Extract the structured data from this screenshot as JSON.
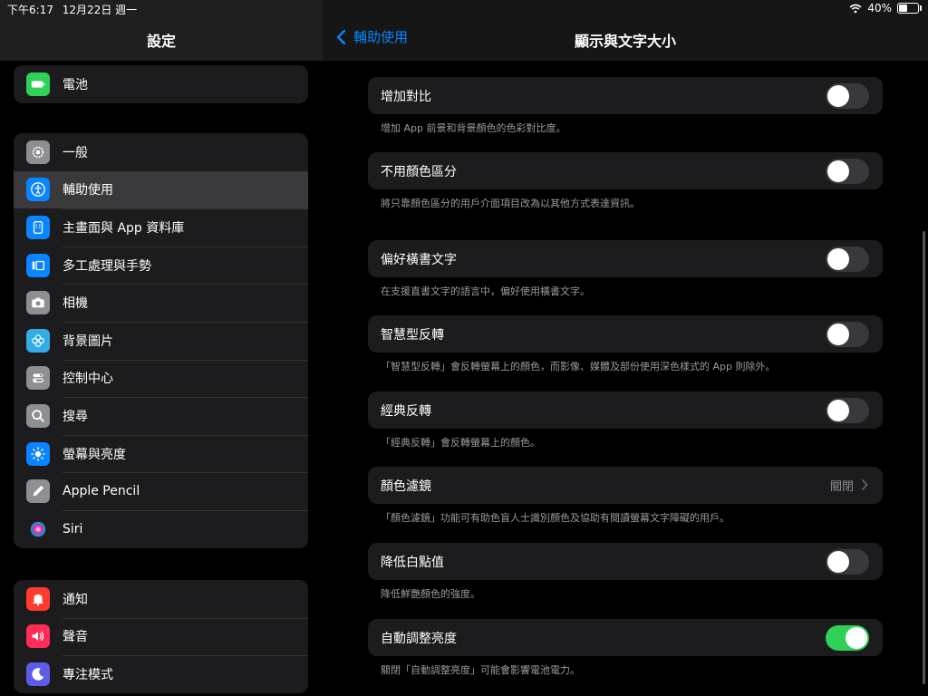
{
  "status": {
    "time": "下午6:17",
    "date": "12月22日 週一",
    "battery": "40%"
  },
  "sidebar": {
    "title": "設定",
    "group_top": [
      {
        "label": "電池",
        "icon": "battery-icon",
        "color": "#30d158"
      }
    ],
    "group_main": [
      {
        "label": "一般",
        "icon": "gear-icon",
        "color": "#8e8e93"
      },
      {
        "label": "輔助使用",
        "icon": "accessibility-icon",
        "color": "#0a84ff",
        "selected": true
      },
      {
        "label": "主畫面與 App 資料庫",
        "icon": "home-screen-icon",
        "color": "#0a84ff"
      },
      {
        "label": "多工處理與手勢",
        "icon": "multitasking-icon",
        "color": "#0a84ff"
      },
      {
        "label": "相機",
        "icon": "camera-icon",
        "color": "#8e8e93"
      },
      {
        "label": "背景圖片",
        "icon": "wallpaper-icon",
        "color": "#32ade6"
      },
      {
        "label": "控制中心",
        "icon": "control-center-icon",
        "color": "#8e8e93"
      },
      {
        "label": "搜尋",
        "icon": "search-icon",
        "color": "#8e8e93"
      },
      {
        "label": "螢幕與亮度",
        "icon": "brightness-icon",
        "color": "#0a84ff"
      },
      {
        "label": "Apple Pencil",
        "icon": "pencil-icon",
        "color": "#8e8e93"
      },
      {
        "label": "Siri",
        "icon": "siri-icon",
        "color": "#1c1c1e"
      }
    ],
    "group_bottom": [
      {
        "label": "通知",
        "icon": "notification-icon",
        "color": "#ff3b30"
      },
      {
        "label": "聲音",
        "icon": "sound-icon",
        "color": "#ff2d55"
      },
      {
        "label": "專注模式",
        "icon": "moon-icon",
        "color": "#5e5ce6"
      }
    ]
  },
  "main": {
    "back_label": "輔助使用",
    "title": "顯示與文字大小",
    "rows": [
      {
        "label": "增加對比",
        "type": "toggle",
        "on": false,
        "desc": "增加 App 前景和背景顏色的色彩對比度。"
      },
      {
        "label": "不用顏色區分",
        "type": "toggle",
        "on": false,
        "desc": "將只靠顏色區分的用戶介面項目改為以其他方式表達資訊。"
      },
      {
        "label": "偏好橫書文字",
        "type": "toggle",
        "on": false,
        "desc": "在支援直書文字的語言中，偏好使用橫書文字。"
      },
      {
        "label": "智慧型反轉",
        "type": "toggle",
        "on": false,
        "desc": "「智慧型反轉」會反轉螢幕上的顏色，而影像、媒體及部份使用深色樣式的 App 則除外。"
      },
      {
        "label": "經典反轉",
        "type": "toggle",
        "on": false,
        "desc": "「經典反轉」會反轉螢幕上的顏色。"
      },
      {
        "label": "顏色濾鏡",
        "type": "link",
        "value": "關閉",
        "desc": "「顏色濾鏡」功能可有助色盲人士識別顏色及協助有閱讀螢幕文字障礙的用戶。"
      },
      {
        "label": "降低白點值",
        "type": "toggle",
        "on": false,
        "desc": "降低鮮艷顏色的強度。"
      },
      {
        "label": "自動調整亮度",
        "type": "toggle",
        "on": true,
        "desc": "關閉「自動調整亮度」可能會影響電池電力。"
      }
    ]
  }
}
